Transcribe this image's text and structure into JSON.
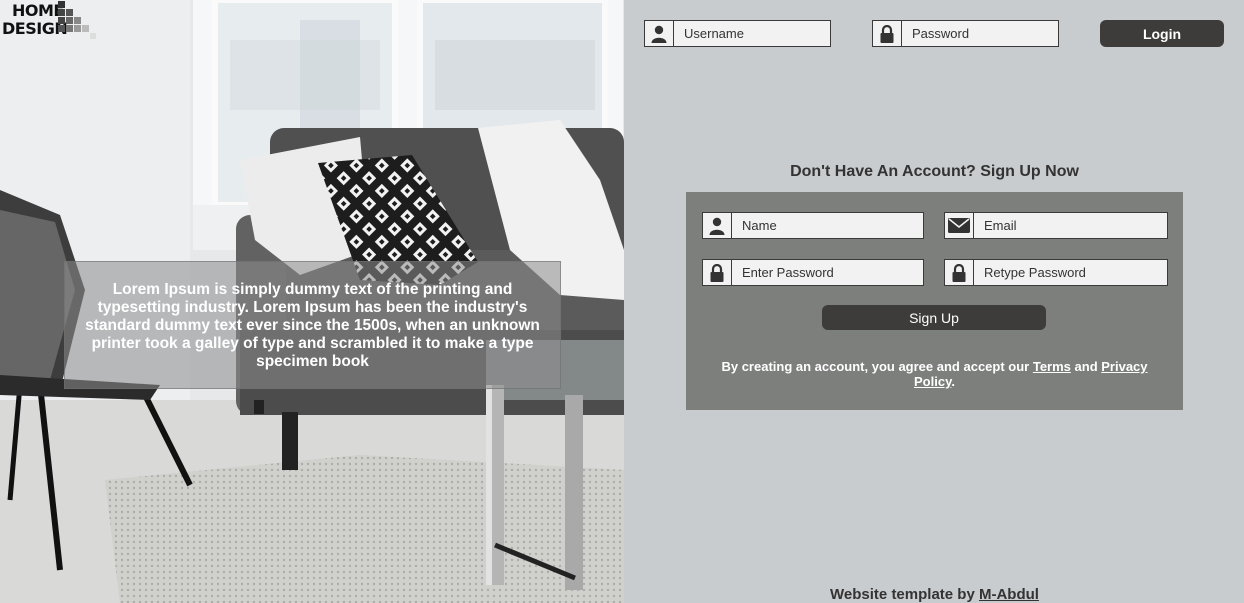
{
  "logo": {
    "line1": "HOME",
    "line2": "DESIGN"
  },
  "hero": {
    "text": "Lorem Ipsum is simply dummy text of the printing and typesetting industry. Lorem Ipsum has been the industry's standard dummy text ever since the 1500s, when an unknown printer took a galley of type and scrambled it to make a type specimen book"
  },
  "login": {
    "username_placeholder": "Username",
    "password_placeholder": "Password",
    "button_label": "Login"
  },
  "signup": {
    "title": "Don't Have An Account? Sign Up Now",
    "name_placeholder": "Name",
    "email_placeholder": "Email",
    "password_placeholder": "Enter Password",
    "retype_placeholder": "Retype Password",
    "button_label": "Sign Up",
    "terms_prefix": "By creating an account, you agree and accept our ",
    "terms_link": "Terms",
    "terms_and": " and ",
    "privacy_link": "Privacy Policy",
    "terms_suffix": "."
  },
  "footer": {
    "prefix": "Website template by ",
    "author_link": "M-Abdul"
  },
  "icons": {
    "user": "user-icon",
    "lock": "lock-icon",
    "email": "envelope-icon"
  },
  "colors": {
    "panel_bg": "#c9ccce",
    "signup_box": "#7d7f7d",
    "button": "#3e3b3b"
  }
}
